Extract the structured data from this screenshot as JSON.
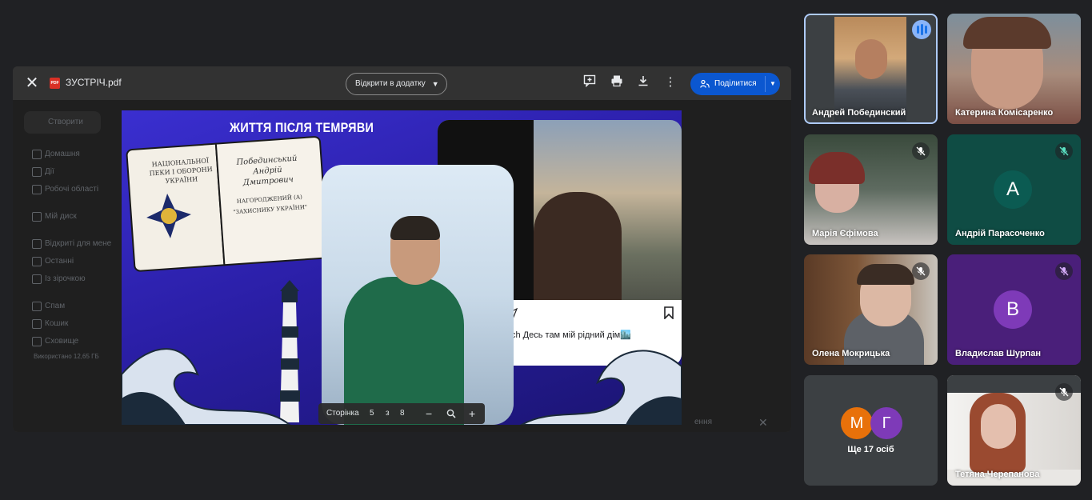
{
  "viewer": {
    "file_name": "ЗУСТРІЧ.pdf",
    "open_with_label": "Відкрити в додатку",
    "share_label": "Поділитися",
    "slide_title": "ЖИТТЯ ПІСЛЯ ТЕМРЯВИ",
    "caption": "ch Десь там мій рідний дім🏙️",
    "page": {
      "label": "Сторінка",
      "current": "5",
      "of": "з",
      "total": "8"
    },
    "book_lines": [
      "НАЦІОНАЛЬНОЇ",
      "ПЕКИ І ОБОРОНИ",
      "УКРАЇНИ"
    ],
    "book_right_lines": [
      "Побединський",
      "Андрій",
      "Дмитрович",
      "НАГОРОДЖЕНИЙ (А)",
      "\"ЗАХИСНИКУ УКРАЇНИ\""
    ]
  },
  "drive_background": {
    "create_label": "Створити",
    "items": [
      "Домашня",
      "Дії",
      "Робочі області",
      "Мій диск",
      "Відкриті для мене",
      "Останні",
      "Із зірочкою",
      "Спам",
      "Кошик",
      "Сховище"
    ],
    "storage_text": "Використано 12,65 ГБ",
    "side_text": "ення"
  },
  "participants": [
    {
      "name": "Андрей Побединский",
      "speaking": true,
      "muted": false
    },
    {
      "name": "Катерина Комісаренко",
      "muted": false
    },
    {
      "name": "Марія Єфімова",
      "muted": true
    },
    {
      "name": "Андрій Парасоченко",
      "muted": true,
      "initial": "A",
      "color": "#0b5b52"
    },
    {
      "name": "Олена Мокрицька",
      "muted": true
    },
    {
      "name": "Владислав Шурпан",
      "muted": true,
      "initial": "B",
      "color": "#7e3ab8"
    },
    {
      "more": "Ще 17 осіб",
      "initials": [
        "М",
        "Г"
      ],
      "colors": [
        "#e8710a",
        "#7e3ab8"
      ]
    },
    {
      "name": "Тетяна Черепанова",
      "muted": true
    }
  ],
  "colors": {
    "accent": "#0b57d0",
    "background": "#202124",
    "speaking_ring": "#aecbfa"
  }
}
